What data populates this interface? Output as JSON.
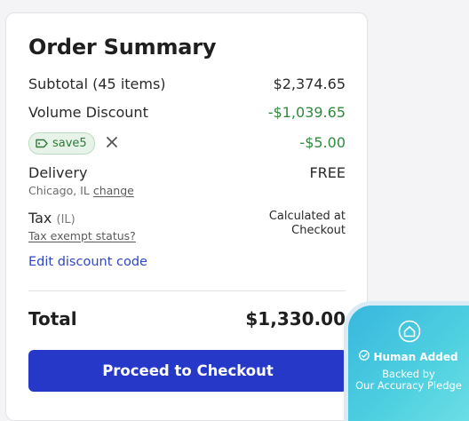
{
  "summary": {
    "title": "Order Summary",
    "subtotal": {
      "label": "Subtotal (45 items)",
      "value": "$2,374.65"
    },
    "volume_discount": {
      "label": "Volume Discount",
      "value": "-$1,039.65"
    },
    "promo": {
      "code": "save5",
      "value": "-$5.00"
    },
    "delivery": {
      "label": "Delivery",
      "value": "FREE",
      "location": "Chicago, IL",
      "change_label": "change"
    },
    "tax": {
      "label": "Tax",
      "region": "(IL)",
      "note_line1": "Calculated at",
      "note_line2": "Checkout",
      "exempt_link": "Tax exempt status?"
    },
    "edit_discount_label": "Edit discount code",
    "total": {
      "label": "Total",
      "value": "$1,330.00"
    },
    "checkout_label": "Proceed to Checkout"
  },
  "badge": {
    "title": "Human Added",
    "line1": "Backed by",
    "line2": "Our Accuracy Pledge"
  },
  "colors": {
    "accent": "#2638c8",
    "discount_green": "#2e8b3d",
    "link_blue": "#2f47c4",
    "badge_cyan": "#4ed0e0"
  },
  "icons": [
    "tag-icon",
    "close-icon",
    "house-icon",
    "check-circle-icon"
  ]
}
